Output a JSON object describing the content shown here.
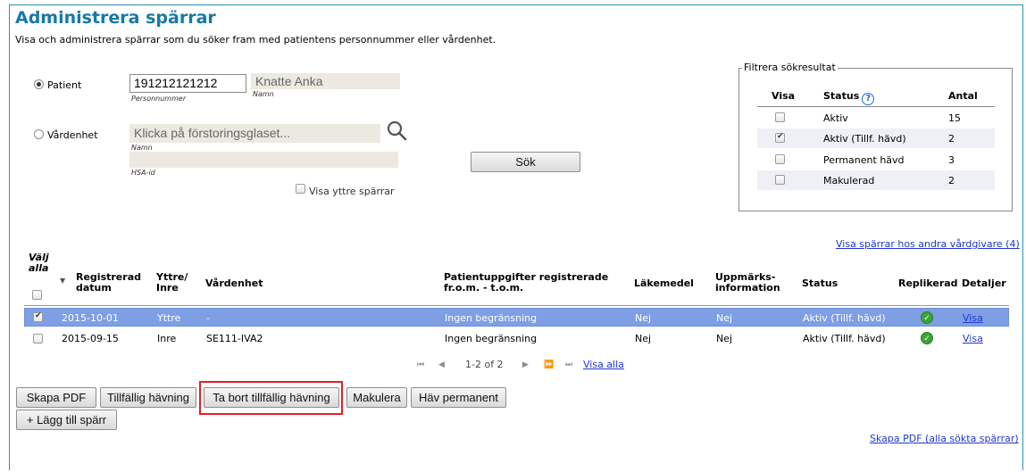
{
  "header": {
    "title": "Administrera spärrar",
    "subtitle": "Visa och administrera spärrar som du söker fram med patientens personnummer eller vårdenhet."
  },
  "search": {
    "patient_label": "Patient",
    "personnummer_value": "191212121212",
    "personnummer_caption": "Personnummer",
    "name_value": "Knatte Anka",
    "name_caption": "Namn",
    "vardenhet_label": "Vårdenhet",
    "vardenhet_placeholder": "Klicka på förstoringsglaset...",
    "vardenhet_name_caption": "Namn",
    "hsa_caption": "HSA-id",
    "outer_checkbox_label": "Visa yttre spärrar",
    "search_button": "Sök",
    "selected_mode": "Patient",
    "search_icon": "magnifier-icon"
  },
  "filter": {
    "legend": "Filtrera sökresultat",
    "col_show": "Visa",
    "col_status": "Status",
    "col_count": "Antal",
    "help_icon": "?",
    "rows": [
      {
        "status": "Aktiv",
        "count": "15",
        "checked": false
      },
      {
        "status": "Aktiv (Tillf. hävd)",
        "count": "2",
        "checked": true
      },
      {
        "status": "Permanent hävd",
        "count": "3",
        "checked": false
      },
      {
        "status": "Makulerad",
        "count": "2",
        "checked": false
      }
    ]
  },
  "other_providers_link": "Visa spärrar hos andra vårdgivare (4)",
  "table": {
    "select_all": "Välj alla",
    "headers": {
      "registered": "Registrerad datum",
      "outer_inner": "Yttre/ Inre",
      "unit": "Vårdenhet",
      "patient_data": "Patientuppgifter registrerade fr.o.m. - t.o.m.",
      "medicine": "Läkemedel",
      "attention": "Uppmärks- information",
      "status": "Status",
      "replicated": "Replikerad",
      "details": "Detaljer"
    },
    "rows": [
      {
        "date": "2015-10-01",
        "type": "Yttre",
        "unit": "-",
        "period": "Ingen begränsning",
        "medicine": "Nej",
        "attention": "Nej",
        "status": "Aktiv (Tillf. hävd)",
        "details": "Visa",
        "selected": true
      },
      {
        "date": "2015-09-15",
        "type": "Inre",
        "unit": "SE111-IVA2",
        "period": "Ingen begränsning",
        "medicine": "Nej",
        "attention": "Nej",
        "status": "Aktiv (Tillf. hävd)",
        "details": "Visa",
        "selected": false
      }
    ]
  },
  "pager": {
    "range": "1-2 of 2",
    "show_all": "Visa alla"
  },
  "actions": {
    "create_pdf": "Skapa PDF",
    "temporary_revoke": "Tillfällig hävning",
    "remove_temporary_revoke": "Ta bort tillfällig hävning",
    "cancel": "Makulera",
    "revoke_permanent": "Häv permanent",
    "add_block": "+ Lägg till spärr"
  },
  "pdf_all_link": "Skapa PDF (alla sökta spärrar)",
  "colors": {
    "title": "#1579a8",
    "selected_row": "#7e9fe4",
    "highlight": "#e0202a"
  }
}
